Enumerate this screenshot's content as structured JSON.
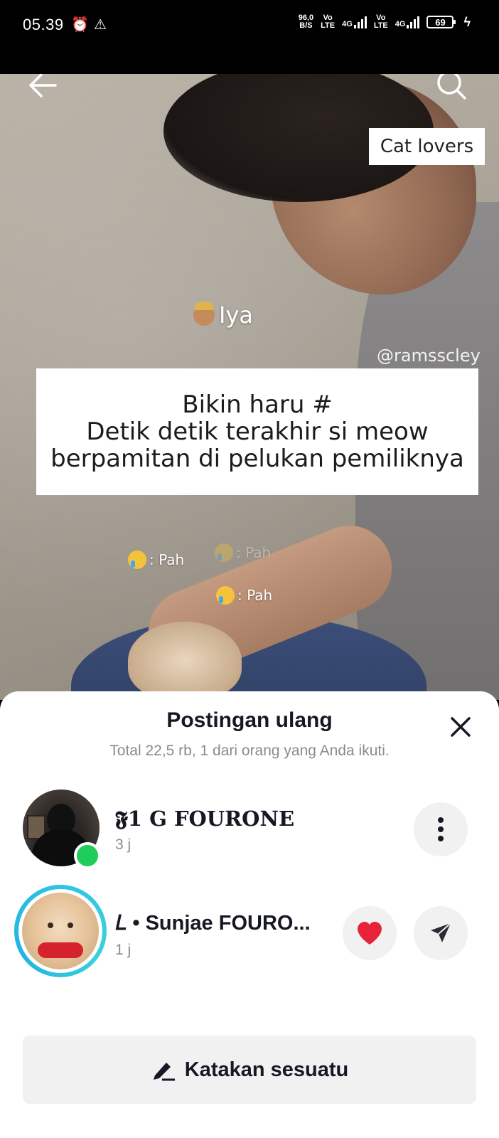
{
  "status_bar": {
    "time": "05.39",
    "net_speed_top": "96,0",
    "net_speed_bottom": "B/S",
    "sim1_top": "Vo",
    "sim1_bottom": "LTE",
    "sim1_net": "4G",
    "sim2_top": "Vo",
    "sim2_bottom": "LTE",
    "sim2_net": "4G",
    "battery": "69"
  },
  "video": {
    "tag": "Cat lovers",
    "overlay_text": "Iya",
    "watermark": "@ramsscley",
    "caption_line1": "Bikin haru #",
    "caption_line2": "Detik detik terakhir si meow",
    "caption_line3": "berpamitan di pelukan pemiliknya",
    "reaction1": ": Pah",
    "reaction2": ": Pah",
    "reaction3": ": Pah"
  },
  "sheet": {
    "title": "Postingan ulang",
    "subtitle": "Total 22,5 rb, 1 dari orang yang Anda ikuti.",
    "users": [
      {
        "name": "𝕱1 G FOURONE",
        "time": "3 j"
      },
      {
        "name": "𝐿 • Sunjae FOURO...",
        "time": "1 j"
      }
    ],
    "say_button": "Katakan sesuatu"
  },
  "icons": {
    "back": "arrow-left-icon",
    "search": "search-icon",
    "close": "close-icon",
    "more": "more-vertical-icon",
    "like": "heart-icon",
    "send": "send-icon",
    "edit": "pencil-icon"
  },
  "colors": {
    "online": "#1fcc5c",
    "story_ring": "#2ec4e6",
    "heart": "#e8223a"
  }
}
